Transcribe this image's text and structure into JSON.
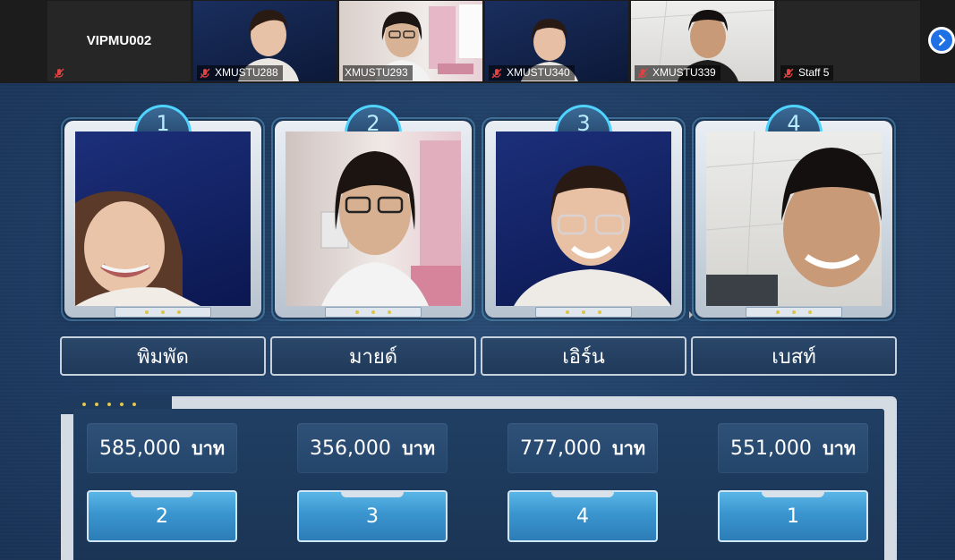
{
  "top_strip": {
    "host_tile": {
      "label": "VIPMU002"
    },
    "participants": [
      {
        "name": "XMUSTU288"
      },
      {
        "name": "XMUSTU293"
      },
      {
        "name": "XMUSTU340"
      },
      {
        "name": "XMUSTU339"
      },
      {
        "name": "Staff 5"
      }
    ]
  },
  "players": [
    {
      "number": "1",
      "name": "พิมพัด",
      "money": "585,000",
      "unit": "บาท",
      "rank": "2"
    },
    {
      "number": "2",
      "name": "มายด์",
      "money": "356,000",
      "unit": "บาท",
      "rank": "3"
    },
    {
      "number": "3",
      "name": "เอิร์น",
      "money": "777,000",
      "unit": "บาท",
      "rank": "4"
    },
    {
      "number": "4",
      "name": "เบสท์",
      "money": "551,000",
      "unit": "บาท",
      "rank": "1"
    }
  ],
  "icons": {
    "muted_mic": "mic-muted-icon",
    "next_page": "chevron-right-icon"
  }
}
